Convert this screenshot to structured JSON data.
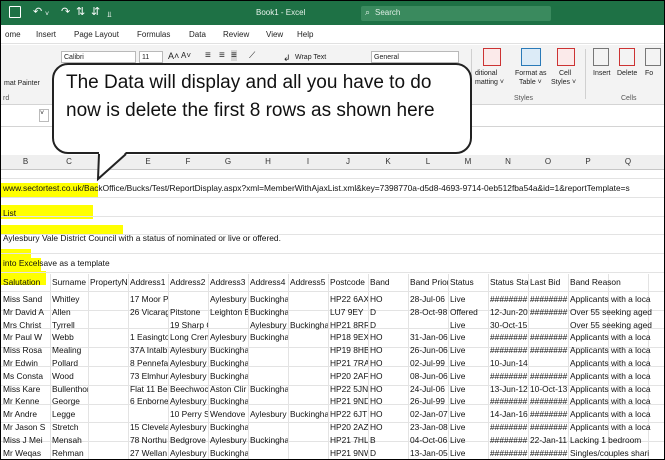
{
  "window": {
    "title": "Book1 - Excel",
    "search_placeholder": "Search"
  },
  "menu": [
    "ome",
    "Insert",
    "Page Layout",
    "Formulas",
    "Data",
    "Review",
    "View",
    "Help"
  ],
  "ribbon": {
    "font_name": "Calibri",
    "font_size": "11",
    "grow_font": "A˄",
    "shrink_font": "A˅",
    "wrap_text": "Wrap Text",
    "number_format": "General",
    "format_painter": "mat Painter",
    "clipboard_group": "rd",
    "conditional_formatting": [
      "ditional",
      "matting ˅"
    ],
    "format_as_table": [
      "Format as",
      "Table ˅"
    ],
    "cell_styles": [
      "Cell",
      "Styles ˅"
    ],
    "styles_group": "Styles",
    "insert": "Insert",
    "delete": "Delete",
    "format": "Fo",
    "cells_group": "Cells"
  },
  "callout": {
    "text": "The Data will display and all you have to do now is delete the first 8 rows as shown here"
  },
  "columns": [
    "B",
    "C",
    "D",
    "E",
    "F",
    "G",
    "H",
    "I",
    "J",
    "K",
    "L",
    "M",
    "N",
    "O",
    "P",
    "Q"
  ],
  "sheet": {
    "url_row": "www.sectortest.co.uk/BackOffice/Bucks/Test/ReportDisplay.aspx?xml=MemberWithAjaxList.xml&key=7398770a-d5d8-4693-9714-0eb512fba54a&id=1&reportTemplate=s",
    "list_row": "List",
    "council_row": "Aylesbury Vale District Council with a status of nominated or live or offered.",
    "template_row": "into Excelsave as a template",
    "headers": [
      "Salutation",
      "Surname",
      "PropertyN",
      "Address1",
      "Address2",
      "Address3",
      "Address4",
      "Address5",
      "Postcode",
      "Band",
      "Band Priori",
      "Status",
      "Status Stat",
      "Last Bid",
      "Band Reason"
    ],
    "rows": [
      [
        "Miss Sand",
        "Whitley",
        "",
        "17 Moor Park, Wend",
        "",
        "Aylesbury",
        "Buckinghamshire",
        "",
        "HP22 6AX",
        "HO",
        "28-Jul-06",
        "Live",
        "########",
        "########",
        "Applicants with a loca"
      ],
      [
        "Mr David A",
        "Allen",
        "",
        "26 Vicarag",
        "Pitstone",
        "Leighton B",
        "Buckinghamshire",
        "",
        "LU7 9EY",
        "D",
        "28-Oct-98",
        "Offered",
        "12-Jun-20",
        "########",
        "Over 55 seeking aged"
      ],
      [
        "Mrs Christ",
        "Tyrrell",
        "",
        "",
        "19 Sharp Close",
        "",
        "Aylesbury",
        "Buckingha",
        "HP21 8RR",
        "D",
        "",
        "Live",
        "30-Oct-15",
        "",
        "Over 55 seeking aged"
      ],
      [
        "Mr Paul W",
        "Webb",
        "",
        "1 Easingto",
        "Long Cren",
        "Aylesbury",
        "Buckinghamshire",
        "",
        "HP18 9EX",
        "HO",
        "31-Jan-06",
        "Live",
        "########",
        "########",
        "Applicants with a loca"
      ],
      [
        "Miss Rosa",
        "Mealing",
        "",
        "37A Intalb",
        "Aylesbury",
        "Buckinghamshire",
        "",
        "",
        "HP19 8HB",
        "HO",
        "26-Jun-06",
        "Live",
        "########",
        "########",
        "Applicants with a loca"
      ],
      [
        "Mr Edwin",
        "Pollard",
        "",
        "8 Pennefa",
        "Aylesbury",
        "Buckinghamshire",
        "",
        "",
        "HP21 7RA",
        "HO",
        "02-Jul-99",
        "Live",
        "10-Jun-14",
        "",
        "Applicants with a loca"
      ],
      [
        "Ms Consta",
        "Wood",
        "",
        "73 Elmhur",
        "Aylesbury",
        "Buckinghamshire",
        "",
        "",
        "HP20 2AF",
        "HO",
        "08-Jun-06",
        "Live",
        "########",
        "########",
        "Applicants with a loca"
      ],
      [
        "Miss Kare",
        "Bullenthorpe",
        "",
        "Flat 11 Be",
        "Beechwoc",
        "Aston Clir",
        "Buckinghamshire",
        "",
        "HP22 5JN",
        "HO",
        "24-Jul-06",
        "Live",
        "13-Jun-12",
        "10-Oct-13",
        "Applicants with a loca"
      ],
      [
        "Mr Kenne",
        "George",
        "",
        "6 Enborne",
        "Aylesbury",
        "Buckinghamshire",
        "",
        "",
        "HP21 9ND",
        "HO",
        "26-Jul-99",
        "Live",
        "########",
        "########",
        "Applicants with a loca"
      ],
      [
        "Mr Andre",
        "Legge",
        "",
        "",
        "10 Perry S",
        "Wendove",
        "Aylesbury",
        "Buckinghamshire",
        "HP22 6JT",
        "HO",
        "02-Jan-07",
        "Live",
        "14-Jan-16",
        "########",
        "Applicants with a loca"
      ],
      [
        "Mr Jason S",
        "Stretch",
        "",
        "15 Clevela",
        "Aylesbury",
        "Buckinghamshire",
        "",
        "",
        "HP20 2AZ",
        "HO",
        "23-Jan-08",
        "Live",
        "########",
        "########",
        "Applicants with a loca"
      ],
      [
        "Miss J Mei",
        "Mensah",
        "",
        "78 Northu",
        "Bedgrove",
        "Aylesbury",
        "Buckinghamshire",
        "",
        "HP21 7HL",
        "B",
        "04-Oct-06",
        "Live",
        "########",
        "22-Jan-11",
        "Lacking 1 bedroom"
      ],
      [
        "Mr Weqas",
        "Rehman",
        "",
        "27 Wellan",
        "Aylesbury",
        "Buckinghamshire",
        "",
        "",
        "HP21 9NW",
        "D",
        "13-Jan-05",
        "Live",
        "########",
        "########",
        "Singles/couples shari"
      ]
    ]
  },
  "colors": {
    "excel_green": "#1e7145",
    "highlight": "#ffff00"
  }
}
